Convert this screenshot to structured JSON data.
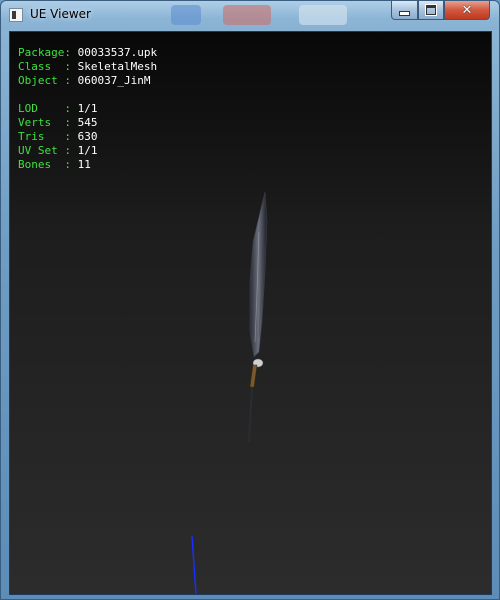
{
  "window": {
    "title": "UE Viewer",
    "controls": [
      "minimize",
      "maximize",
      "close"
    ]
  },
  "info": {
    "object_rows": [
      {
        "label": "Package:",
        "value": "00033537.upk"
      },
      {
        "label": "Class  :",
        "value": "SkeletalMesh"
      },
      {
        "label": "Object :",
        "value": "060037_JinM"
      }
    ],
    "mesh_rows": [
      {
        "label": "LOD    :",
        "value": "1/1"
      },
      {
        "label": "Verts  :",
        "value": "545"
      },
      {
        "label": "Tris   :",
        "value": "630"
      },
      {
        "label": "UV Set :",
        "value": "1/1"
      },
      {
        "label": "Bones  :",
        "value": "11"
      }
    ],
    "label_color": "#40e040",
    "value_color": "#ffffff"
  },
  "icons": {
    "app": "window-app-icon",
    "minimize": "minimize-icon",
    "maximize": "maximize-icon",
    "close": "close-icon"
  }
}
